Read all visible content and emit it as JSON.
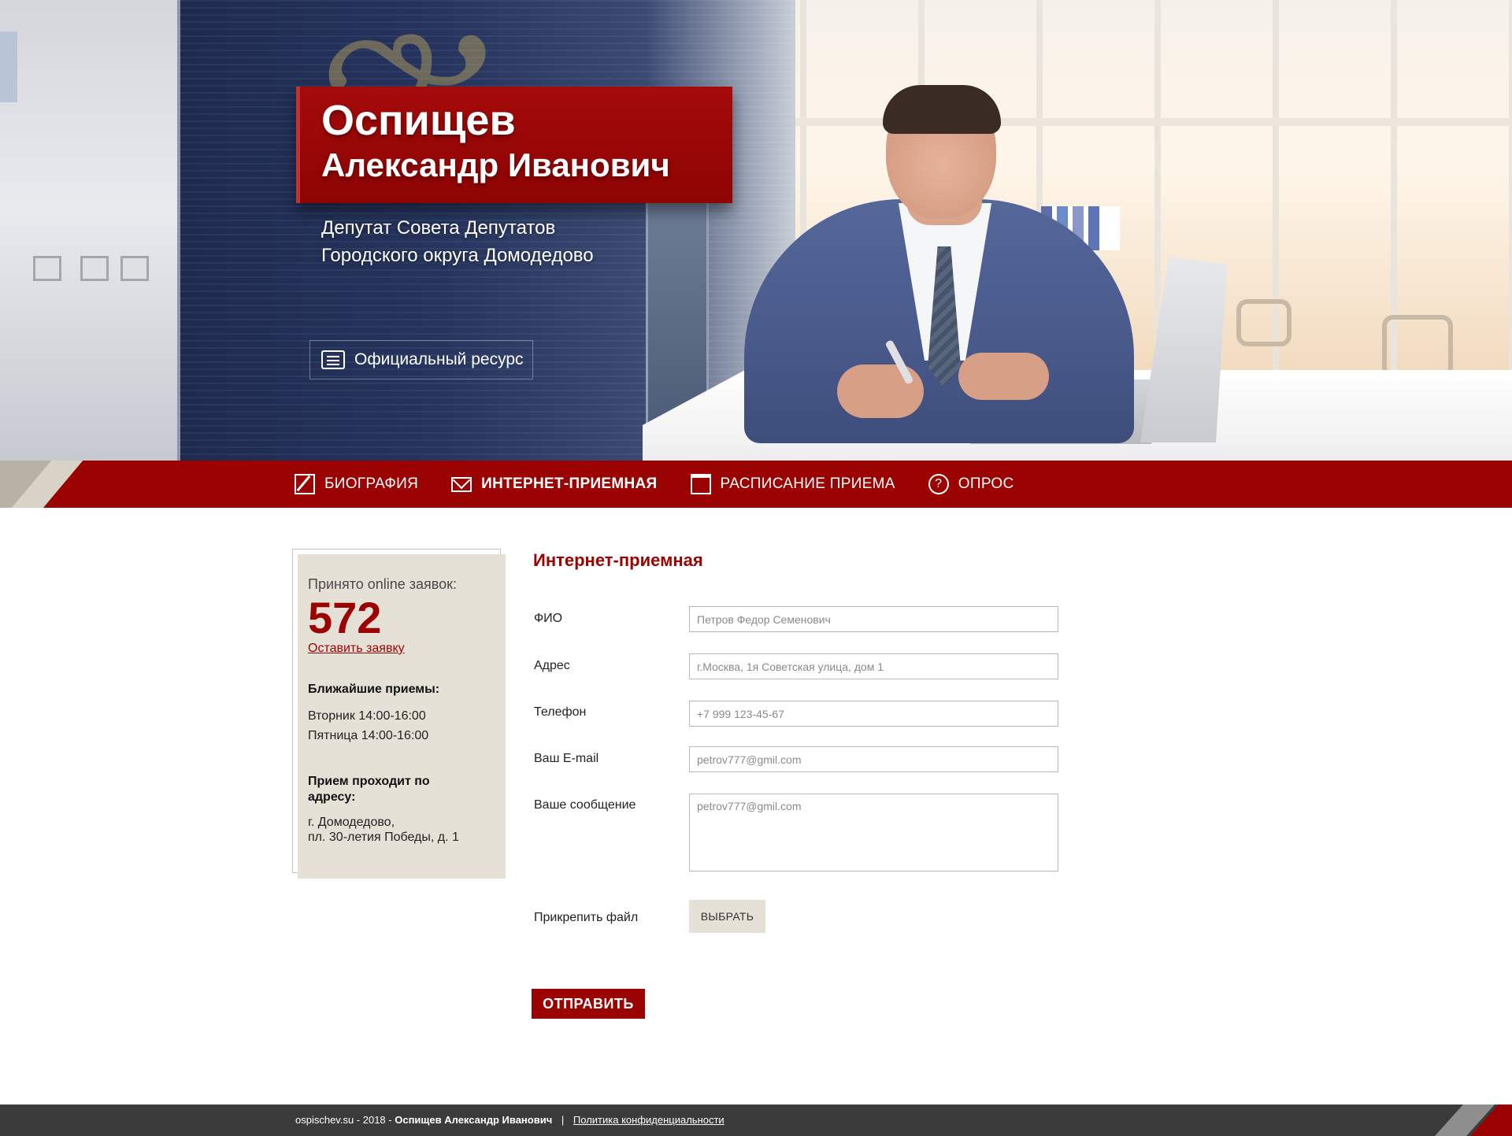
{
  "hero": {
    "surname": "Оспищев",
    "given_names": "Александр Иванович",
    "subtitle_line1": "Депутат Совета Депутатов",
    "subtitle_line2": "Городского округа Домодедово",
    "official_label": "Официальный ресурс",
    "emblem_icon": "double-headed-eagle-emblem"
  },
  "nav": {
    "items": [
      {
        "label": "БИОГРАФИЯ",
        "icon": "pen-icon",
        "active": false
      },
      {
        "label": "ИНТЕРНЕТ-ПРИЕМНАЯ",
        "icon": "mail-icon",
        "active": true
      },
      {
        "label": "РАСПИСАНИЕ ПРИЕМА",
        "icon": "calendar-icon",
        "active": false
      },
      {
        "label": "ОПРОС",
        "icon": "question-icon",
        "active": false
      }
    ]
  },
  "sidebar": {
    "accepted_label": "Принято online заявок:",
    "accepted_count": "572",
    "leave_request_link": "Оставить заявку",
    "nearest_heading": "Ближайшие приемы:",
    "schedule": [
      "Вторник 14:00-16:00",
      "Пятница 14:00-16:00"
    ],
    "address_heading_line1": "Прием проходит по",
    "address_heading_line2": "адресу:",
    "address_line1": "г. Домодедово,",
    "address_line2": "пл. 30-летия Победы, д. 1"
  },
  "form": {
    "title": "Интернет-приемная",
    "fields": [
      {
        "label": "ФИО",
        "placeholder": "Петров Федор Семенович",
        "value": ""
      },
      {
        "label": "Адрес",
        "placeholder": "г.Москва, 1я Советская улица, дом 1",
        "value": ""
      },
      {
        "label": "Телефон",
        "placeholder": "+7 999 123-45-67",
        "value": ""
      },
      {
        "label": "Ваш E-mail",
        "placeholder": "petrov777@gmil.com",
        "value": ""
      }
    ],
    "message_label": "Ваше сообщение",
    "message_placeholder": "petrov777@gmil.com",
    "attach_label": "Прикрепить файл",
    "choose_button": "ВЫБРАТЬ",
    "submit_button": "ОТПРАВИТЬ"
  },
  "footer": {
    "site": "ospischev.su - 2018 -",
    "owner": "Оспищев Александр Иванович",
    "separator": "|",
    "policy_link": "Политика конфиденциальности"
  },
  "colors": {
    "brand_red": "#9b0303",
    "sidebar_beige": "#e6e1d6",
    "footer_dark": "#3b3b3b",
    "hero_blue": "#26345e"
  }
}
